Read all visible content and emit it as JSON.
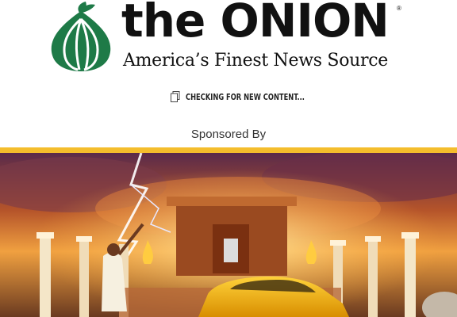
{
  "brand": {
    "name": "the ONION",
    "tagline": "America’s Finest News Source",
    "registered_mark": "®",
    "logo_icon": "onion-icon",
    "logo_color": "#1e7a47"
  },
  "status": {
    "icon": "document-icon",
    "text": "CHECKING FOR NEW CONTENT..."
  },
  "sponsor": {
    "label": "Sponsored By",
    "accent_color": "#f4bd2c"
  },
  "ad": {
    "scene": "temple-lightning-car-scene"
  }
}
